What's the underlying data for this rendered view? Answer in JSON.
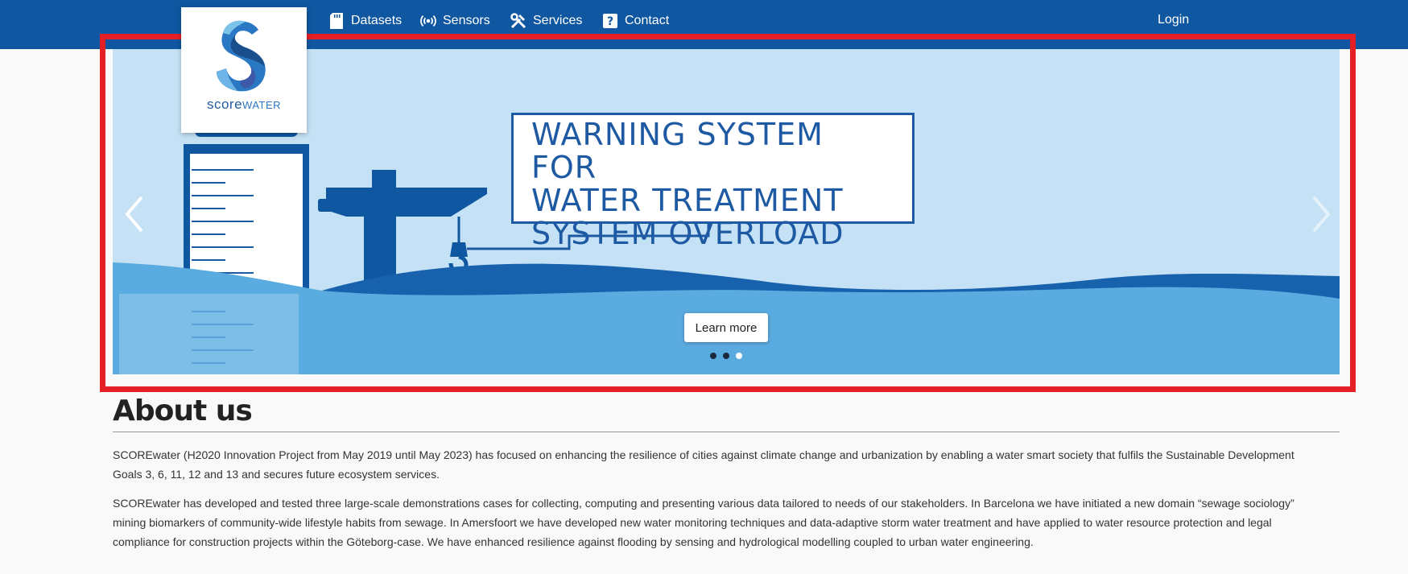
{
  "nav": {
    "items": [
      {
        "label": "Datasets",
        "icon": "sd-card-icon"
      },
      {
        "label": "Sensors",
        "icon": "broadcast-icon"
      },
      {
        "label": "Services",
        "icon": "tools-icon"
      },
      {
        "label": "Contact",
        "icon": "question-icon"
      }
    ],
    "login_label": "Login"
  },
  "logo": {
    "text_part1": "score",
    "text_part2": "WATER"
  },
  "carousel": {
    "title_lines": [
      "WARNING SYSTEM FOR",
      "WATER TREATMENT",
      "SYSTEM OVERLOAD"
    ],
    "button_label": "Learn more",
    "slide_count": 3,
    "active_slide": 3
  },
  "about": {
    "title": "About us",
    "p1": "SCOREwater (H2020 Innovation Project from May 2019 until May 2023) has focused on enhancing the resilience of cities against climate change and urbanization by enabling a water smart society that fulfils the Sustainable Development Goals 3, 6, 11, 12 and 13 and secures future ecosystem services.",
    "p2": "SCOREwater has developed and tested three large-scale demonstrations cases for collecting, computing and presenting various data tailored to needs of our stakeholders. In Barcelona we have initiated a new domain “sewage sociology” mining biomarkers of community-wide lifestyle habits from sewage. In Amersfoort we have developed new water monitoring techniques and data-adaptive storm water treatment and have applied to water resource protection and legal compliance for construction projects within the Göteborg-case. We have enhanced resilience against flooding by sensing and hydrological modelling coupled to urban water engineering."
  },
  "colors": {
    "navbar": "#0f57a0",
    "highlight": "#e41f25",
    "sky": "#c5e1f5",
    "water": "#5aabe0",
    "dark_blue": "#1e5aa3"
  }
}
